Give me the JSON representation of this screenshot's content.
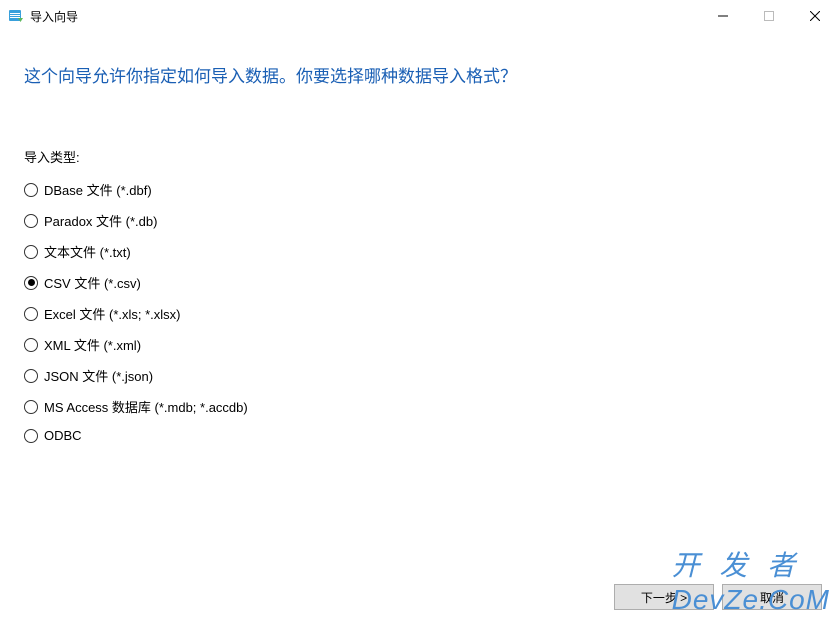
{
  "window": {
    "title": "导入向导"
  },
  "heading": "这个向导允许你指定如何导入数据。你要选择哪种数据导入格式？",
  "section_label": "导入类型:",
  "options": [
    {
      "label": "DBase 文件 (*.dbf)",
      "selected": false
    },
    {
      "label": "Paradox 文件 (*.db)",
      "selected": false
    },
    {
      "label": "文本文件 (*.txt)",
      "selected": false
    },
    {
      "label": "CSV 文件 (*.csv)",
      "selected": true
    },
    {
      "label": "Excel 文件 (*.xls; *.xlsx)",
      "selected": false
    },
    {
      "label": "XML 文件 (*.xml)",
      "selected": false
    },
    {
      "label": "JSON 文件 (*.json)",
      "selected": false
    },
    {
      "label": "MS Access 数据库 (*.mdb; *.accdb)",
      "selected": false
    },
    {
      "label": "ODBC",
      "selected": false
    }
  ],
  "buttons": {
    "next": "下一步 >",
    "cancel": "取消"
  },
  "watermark": {
    "cn": "开 发 者",
    "en": "DevZe.CoM"
  }
}
